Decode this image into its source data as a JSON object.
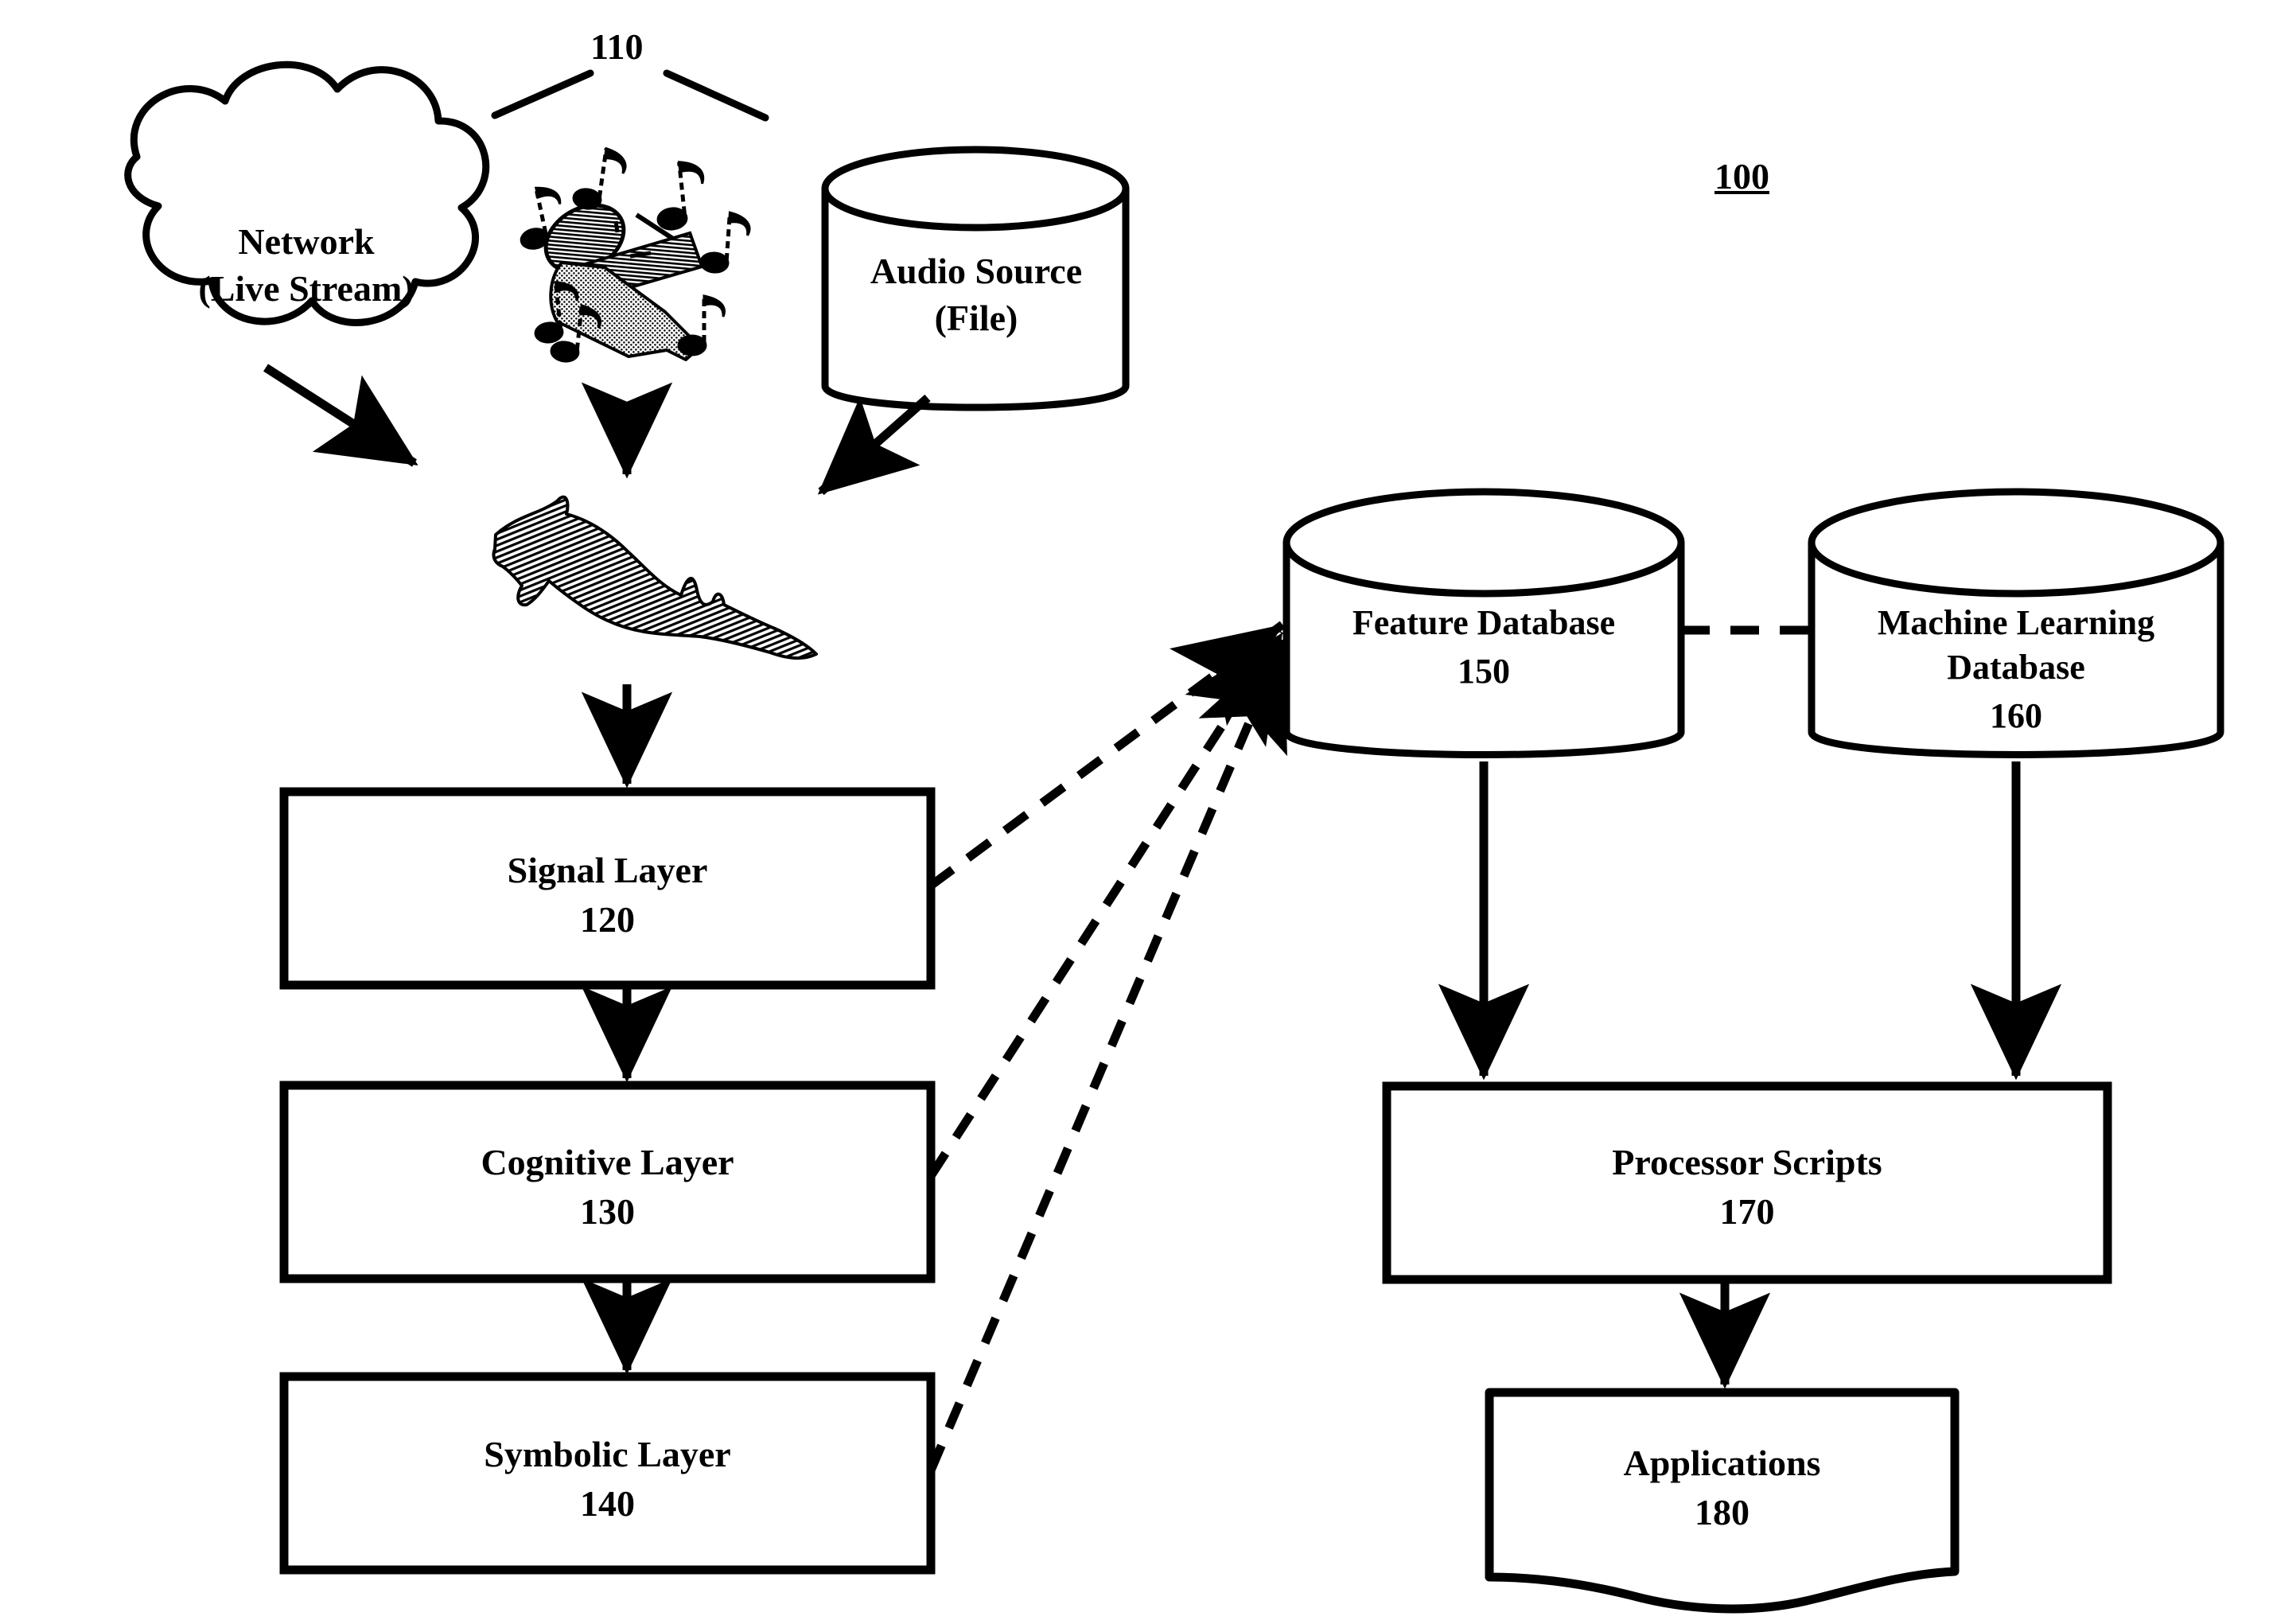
{
  "figure": {
    "figure_ref": "100",
    "sources_bracket_ref": "110"
  },
  "nodes": {
    "network_cloud": {
      "label": "Network\n(Live Stream)"
    },
    "microphone_icon": {
      "name": "microphone-with-music-notes"
    },
    "audio_source": {
      "label": "Audio Source\n(File)"
    },
    "waveform_icon": {
      "name": "audio-waveform"
    },
    "signal_layer": {
      "label": "Signal Layer",
      "ref": "120"
    },
    "cognitive_layer": {
      "label": "Cognitive Layer",
      "ref": "130"
    },
    "symbolic_layer": {
      "label": "Symbolic Layer",
      "ref": "140"
    },
    "feature_database": {
      "label": "Feature Database",
      "ref": "150"
    },
    "machine_learning_database": {
      "label": "Machine Learning\nDatabase",
      "ref": "160"
    },
    "processor_scripts": {
      "label": "Processor Scripts",
      "ref": "170"
    },
    "applications": {
      "label": "Applications",
      "ref": "180"
    }
  },
  "edges": [
    {
      "name": "network-to-waveform",
      "style": "solid-arrow",
      "from": "network_cloud",
      "to": "waveform_icon"
    },
    {
      "name": "microphone-to-waveform",
      "style": "solid-arrow",
      "from": "microphone_icon",
      "to": "waveform_icon"
    },
    {
      "name": "audio-source-to-waveform",
      "style": "solid-arrow",
      "from": "audio_source",
      "to": "waveform_icon"
    },
    {
      "name": "waveform-to-signal-layer",
      "style": "solid-arrow",
      "from": "waveform_icon",
      "to": "signal_layer"
    },
    {
      "name": "signal-to-cognitive",
      "style": "solid-arrow",
      "from": "signal_layer",
      "to": "cognitive_layer"
    },
    {
      "name": "cognitive-to-symbolic",
      "style": "solid-arrow",
      "from": "cognitive_layer",
      "to": "symbolic_layer"
    },
    {
      "name": "signal-to-feature-db",
      "style": "dashed-arrow",
      "from": "signal_layer",
      "to": "feature_database"
    },
    {
      "name": "cognitive-to-feature-db",
      "style": "dashed-arrow",
      "from": "cognitive_layer",
      "to": "feature_database"
    },
    {
      "name": "symbolic-to-feature-db",
      "style": "dashed-arrow",
      "from": "symbolic_layer",
      "to": "feature_database"
    },
    {
      "name": "feature-db-to-ml-db",
      "style": "dashed-line",
      "from": "feature_database",
      "to": "machine_learning_database"
    },
    {
      "name": "feature-db-to-processor",
      "style": "solid-arrow",
      "from": "feature_database",
      "to": "processor_scripts"
    },
    {
      "name": "ml-db-to-processor",
      "style": "solid-arrow",
      "from": "machine_learning_database",
      "to": "processor_scripts"
    },
    {
      "name": "processor-to-applications",
      "style": "solid-arrow",
      "from": "processor_scripts",
      "to": "applications"
    }
  ],
  "colors": {
    "stroke": "#000000",
    "background": "#ffffff"
  }
}
